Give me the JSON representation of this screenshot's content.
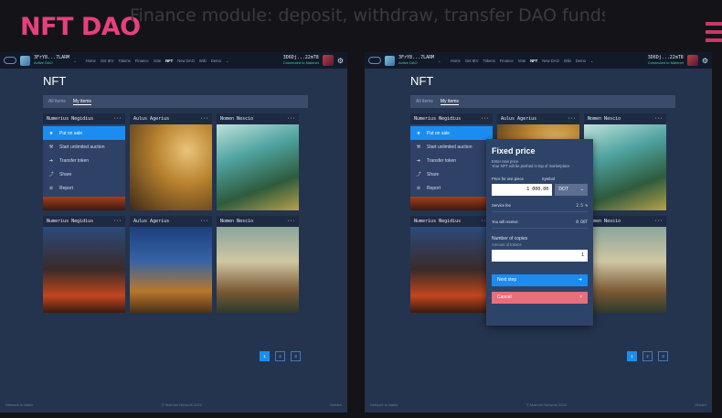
{
  "slide": {
    "title": "NFT DAO",
    "subtitle": "Finance module: deposit, withdraw, transfer DAO funds"
  },
  "topbar": {
    "dao_address": "3FrY8...7LARM",
    "dao_sub_left": "Active DAO",
    "dao_sub_right": "Active DAO",
    "nav": [
      "Home",
      "Get IEV",
      "Tokens",
      "Finance",
      "Vote",
      "NFT",
      "New DAO",
      "Wiki",
      "Demo"
    ],
    "active_nav": "NFT",
    "user_address": "3D6Dj...22mT8",
    "user_status_left": "Connected to Mainnet",
    "user_status_right": "Connected to Mainnet"
  },
  "page": {
    "title": "NFT",
    "tabs": [
      "All items",
      "My items"
    ],
    "active_tab": "My items"
  },
  "cards": [
    {
      "name": "Numerius Negidius",
      "menu": "···"
    },
    {
      "name": "Aulus Agerius",
      "menu": "···"
    },
    {
      "name": "Nomen Nescio",
      "menu": "···"
    },
    {
      "name": "Numerius Negidius",
      "menu": "···"
    },
    {
      "name": "Aulus Agerius",
      "menu": "···"
    },
    {
      "name": "Nomen Nescio",
      "menu": "···"
    }
  ],
  "context_menu": [
    {
      "label": "Put on sale",
      "icon": "★"
    },
    {
      "label": "Start unlimited auction",
      "icon": "⚒"
    },
    {
      "label": "Transfer token",
      "icon": "➔"
    },
    {
      "label": "Share",
      "icon": "⤴"
    },
    {
      "label": "Report",
      "icon": "⊘"
    }
  ],
  "pager": [
    "1",
    "2",
    "3"
  ],
  "footer": {
    "left": "Network is stable",
    "center": "© Mainnet Network 2022",
    "right": "Hidden"
  },
  "modal": {
    "title": "Fixed price",
    "desc_line1": "Enter new price.",
    "desc_line2": "Your NFT will be pushed in top of marketplace",
    "price_label": "Price for one piece",
    "symbol_label": "Symbol",
    "price_value": "1 000.00",
    "symbol_value": "DOT",
    "service_fee_label": "Service fee",
    "service_fee_value": "2.5 %",
    "receive_label": "You will receive",
    "receive_value": "0 DOT",
    "copies_label": "Number of copies",
    "copies_sub": "Amount of tokens",
    "copies_value": "1",
    "next_label": "Next step",
    "next_icon": "➔",
    "cancel_label": "Cancel",
    "cancel_icon": "×"
  }
}
